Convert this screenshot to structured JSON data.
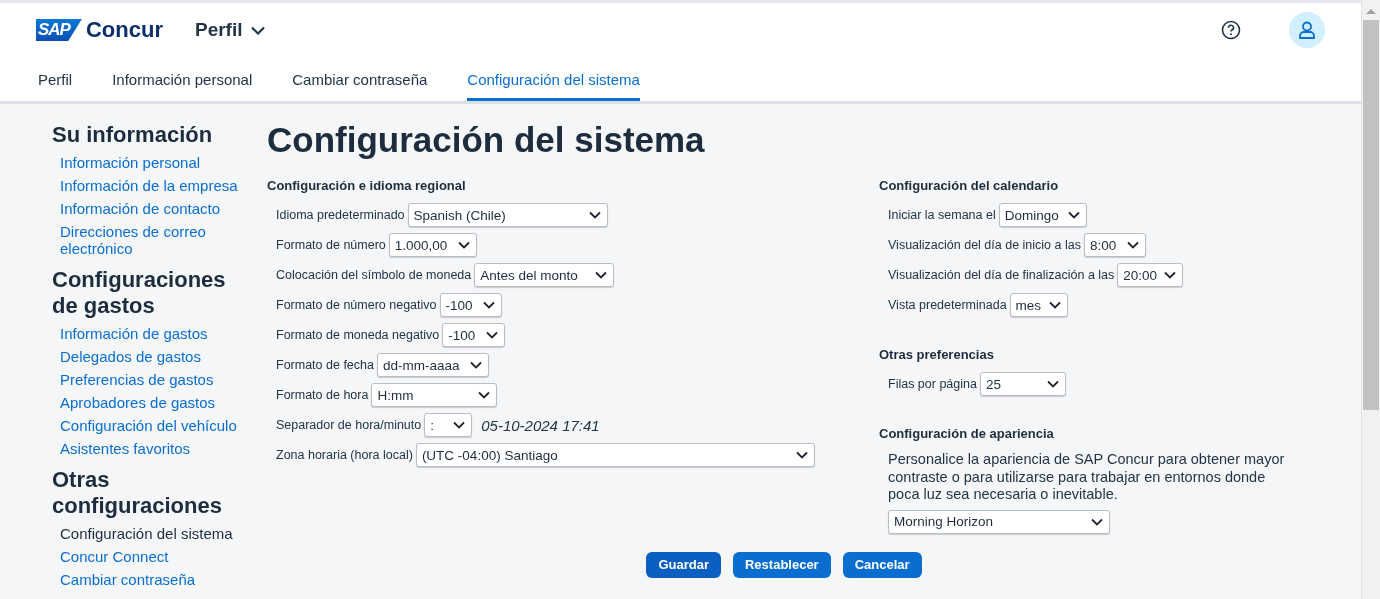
{
  "header": {
    "logo_mark": "SAP",
    "logo_text": "Concur",
    "menu": "Perfil"
  },
  "tabs": [
    {
      "label": "Perfil",
      "selected": false
    },
    {
      "label": "Información personal",
      "selected": false
    },
    {
      "label": "Cambiar contraseña",
      "selected": false
    },
    {
      "label": "Configuración del sistema",
      "selected": true
    }
  ],
  "sidebar": [
    {
      "heading": "Su información",
      "items": [
        {
          "label": "Información personal",
          "selected": false
        },
        {
          "label": "Información de la empresa",
          "selected": false
        },
        {
          "label": "Información de contacto",
          "selected": false
        },
        {
          "label": "Direcciones de correo electrónico",
          "selected": false
        }
      ]
    },
    {
      "heading": "Configuraciones de gastos",
      "items": [
        {
          "label": "Información de gastos",
          "selected": false
        },
        {
          "label": "Delegados de gastos",
          "selected": false
        },
        {
          "label": "Preferencias de gastos",
          "selected": false
        },
        {
          "label": "Aprobadores de gastos",
          "selected": false
        },
        {
          "label": "Configuración del vehículo",
          "selected": false
        },
        {
          "label": "Asistentes favoritos",
          "selected": false
        }
      ]
    },
    {
      "heading": "Otras configuraciones",
      "items": [
        {
          "label": "Configuración del sistema",
          "selected": true
        },
        {
          "label": "Concur Connect",
          "selected": false
        },
        {
          "label": "Cambiar contraseña",
          "selected": false
        }
      ]
    }
  ],
  "page_title": "Configuración del sistema",
  "regional": {
    "title": "Configuración e idioma regional",
    "fields": [
      {
        "label": "Idioma predeterminado",
        "value": "Spanish (Chile)"
      },
      {
        "label": "Formato de número",
        "value": "1.000,00"
      },
      {
        "label": "Colocación del símbolo de moneda",
        "value": "Antes del monto"
      },
      {
        "label": "Formato de número negativo",
        "value": "-100"
      },
      {
        "label": "Formato de moneda negativo",
        "value": "-100"
      },
      {
        "label": "Formato de fecha",
        "value": "dd-mm-aaaa"
      },
      {
        "label": "Formato de hora",
        "value": "H:mm"
      },
      {
        "label": "Separador de hora/minuto",
        "value": ":",
        "preview": "05-10-2024 17:41"
      },
      {
        "label": "Zona horaria (hora local)",
        "value": "(UTC -04:00) Santiago"
      }
    ]
  },
  "calendar": {
    "title": "Configuración del calendario",
    "fields": [
      {
        "label": "Iniciar la semana el",
        "value": "Domingo"
      },
      {
        "label": "Visualización del día de inicio a las",
        "value": "8:00"
      },
      {
        "label": "Visualización del día de finalización a las",
        "value": "20:00"
      },
      {
        "label": "Vista predeterminada",
        "value": "mes"
      }
    ]
  },
  "other": {
    "title": "Otras preferencias",
    "fields": [
      {
        "label": "Filas por página",
        "value": "25"
      }
    ]
  },
  "appearance": {
    "title": "Configuración de apariencia",
    "description": "Personalice la apariencia de SAP Concur para obtener mayor contraste o para utilizarse para trabajar en entornos donde poca luz sea necesaria o inevitable.",
    "value": "Morning Horizon"
  },
  "buttons": [
    "Guardar",
    "Restablecer",
    "Cancelar"
  ]
}
